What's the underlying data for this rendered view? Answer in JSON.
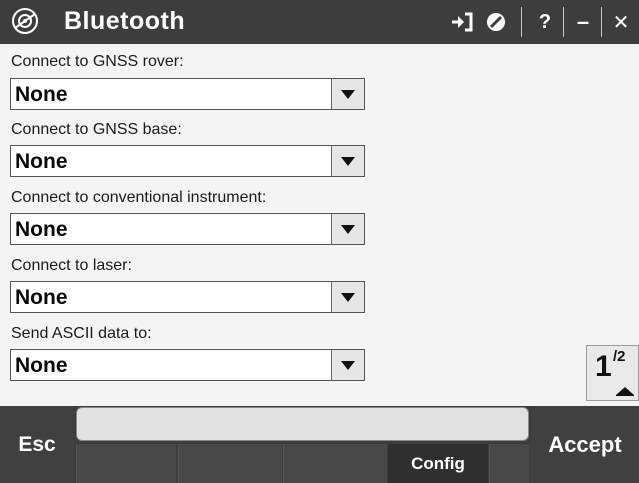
{
  "window": {
    "title": "Bluetooth",
    "icons": [
      "bluetooth-app-icon",
      "exit-icon",
      "no-entry-icon",
      "help-icon",
      "minimize-icon",
      "close-icon"
    ],
    "help_label": "?",
    "minimize_label": "–",
    "close_label": "✕"
  },
  "fields": [
    {
      "label": "Connect to GNSS rover:",
      "value": "None"
    },
    {
      "label": "Connect to GNSS base:",
      "value": "None"
    },
    {
      "label": "Connect to conventional instrument:",
      "value": "None"
    },
    {
      "label": "Connect to laser:",
      "value": "None"
    },
    {
      "label": "Send ASCII data to:",
      "value": "None"
    }
  ],
  "pager": {
    "current": "1",
    "total": "/2"
  },
  "softkeys": {
    "esc": "Esc",
    "accept": "Accept",
    "config": "Config"
  },
  "colors": {
    "titlebar": "#3d3d3d",
    "background": "#f4f4f4",
    "softkey_bar": "#3d3d3d"
  }
}
